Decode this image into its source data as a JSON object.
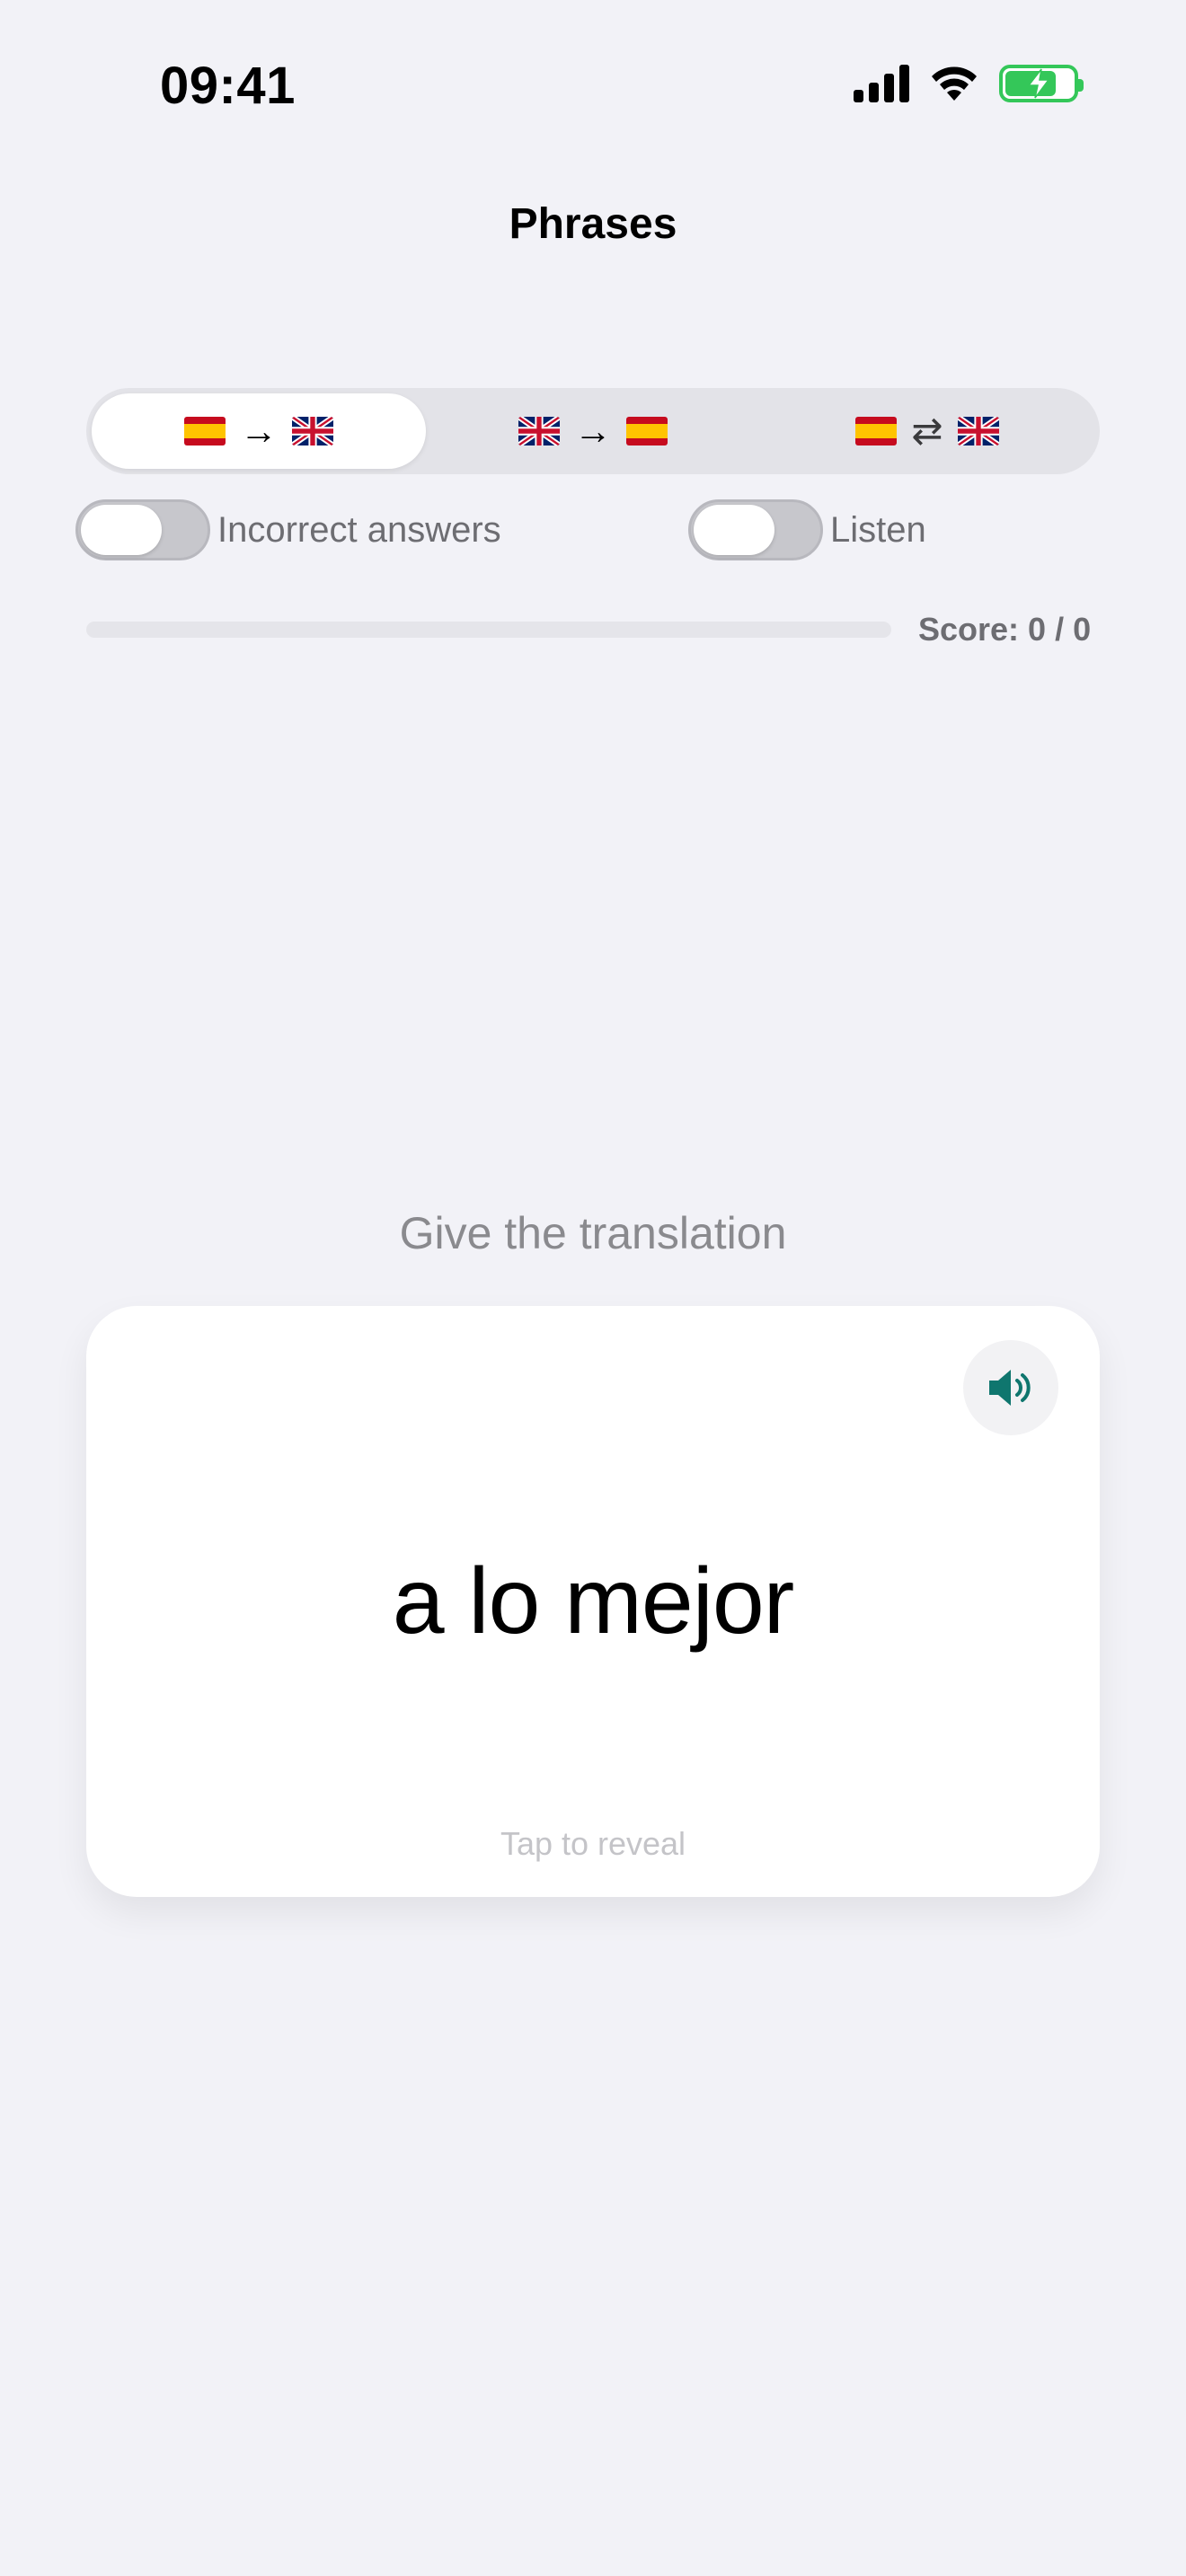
{
  "status_bar": {
    "time": "09:41",
    "icons": [
      "signal-icon",
      "wifi-icon",
      "battery-charging-icon"
    ]
  },
  "header": {
    "title": "Phrases"
  },
  "mode_selector": {
    "segments": [
      {
        "from_flag": "flag-es-icon",
        "arrow": "→",
        "to_flag": "flag-uk-icon",
        "selected": true
      },
      {
        "from_flag": "flag-uk-icon",
        "arrow": "→",
        "to_flag": "flag-es-icon",
        "selected": false
      },
      {
        "from_flag": "flag-es-icon",
        "arrow": "⇄",
        "to_flag": "flag-uk-icon",
        "selected": false
      }
    ]
  },
  "toggles": {
    "incorrect_answers": {
      "label": "Incorrect answers",
      "on": false
    },
    "listen": {
      "label": "Listen",
      "on": false
    }
  },
  "progress": {
    "fraction": 0,
    "score_text": "Score: 0 / 0"
  },
  "prompt": "Give the translation",
  "card": {
    "word": "a lo mejor",
    "hint": "Tap to reveal",
    "speaker_icon": "speaker-icon"
  },
  "colors": {
    "background": "#f2f2f7",
    "accent": "#0f766e",
    "battery": "#34c759"
  }
}
